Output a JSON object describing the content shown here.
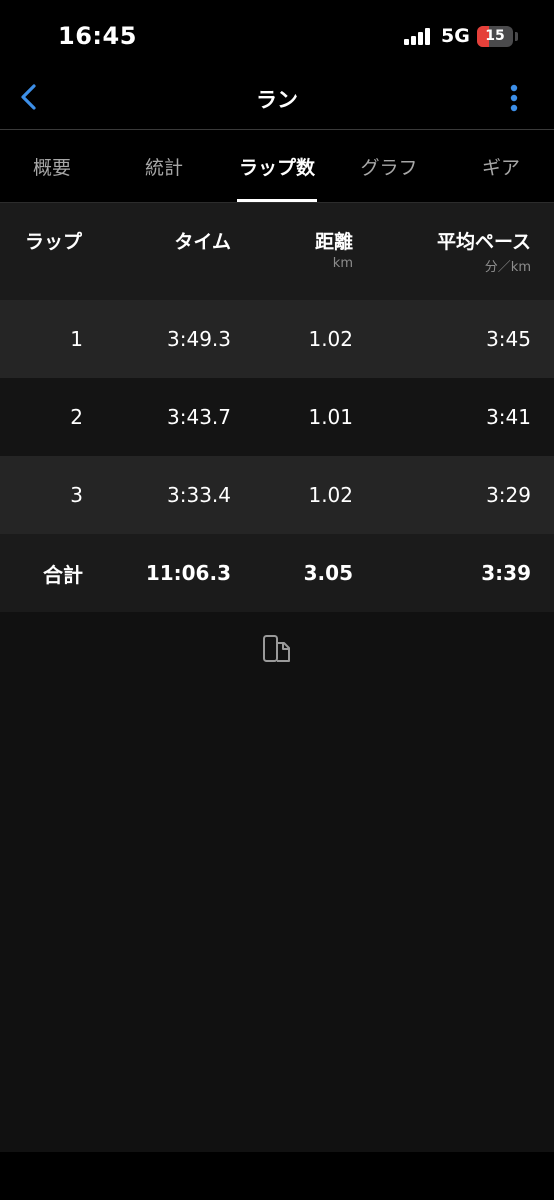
{
  "status_bar": {
    "time": "16:45",
    "network": "5G",
    "battery": "15",
    "battery_level": 0.15
  },
  "nav": {
    "title": "ラン",
    "back_icon": "chevron-left-icon",
    "more_icon": "vertical-ellipsis-icon",
    "accent_color": "#3d8fe8"
  },
  "tabs": [
    {
      "label": "概要"
    },
    {
      "label": "統計"
    },
    {
      "label": "ラップ数"
    },
    {
      "label": "グラフ"
    },
    {
      "label": "ギア"
    }
  ],
  "active_tab": "ラップ数",
  "table": {
    "headers": [
      {
        "label": "ラップ",
        "unit": ""
      },
      {
        "label": "タイム",
        "unit": ""
      },
      {
        "label": "距離",
        "unit": "km"
      },
      {
        "label": "平均ペース",
        "unit": "分／km"
      }
    ],
    "rows": [
      {
        "lap": "1",
        "time": "3:49.3",
        "distance": "1.02",
        "pace": "3:45"
      },
      {
        "lap": "2",
        "time": "3:43.7",
        "distance": "1.01",
        "pace": "3:41"
      },
      {
        "lap": "3",
        "time": "3:33.4",
        "distance": "1.02",
        "pace": "3:29"
      }
    ],
    "total": {
      "lap": "合計",
      "time": "11:06.3",
      "distance": "3.05",
      "pace": "3:39"
    }
  },
  "share_icon": "phone-share-icon"
}
